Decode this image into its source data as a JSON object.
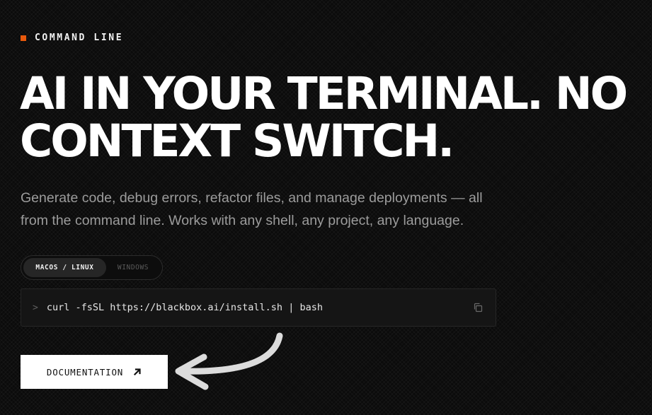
{
  "eyebrow": {
    "label": "COMMAND LINE",
    "accent_color": "#e8590c"
  },
  "headline": {
    "line1": "AI IN YOUR TERMINAL. NO",
    "line2": "CONTEXT SWITCH."
  },
  "subtitle": {
    "line1": "Generate code, debug errors, refactor files, and manage deployments — all",
    "line2": "from the command line. Works with any shell, any project, any language."
  },
  "os_tabs": [
    {
      "label": "MACOS / LINUX",
      "active": true
    },
    {
      "label": "WINDOWS",
      "active": false
    }
  ],
  "command": {
    "prompt": ">",
    "text": "curl -fsSL https://blackbox.ai/install.sh | bash",
    "copy_icon": "copy-icon"
  },
  "cta": {
    "label": "DOCUMENTATION",
    "icon": "arrow-up-right-icon"
  },
  "decor": {
    "pointer": "curved-arrow-icon"
  }
}
